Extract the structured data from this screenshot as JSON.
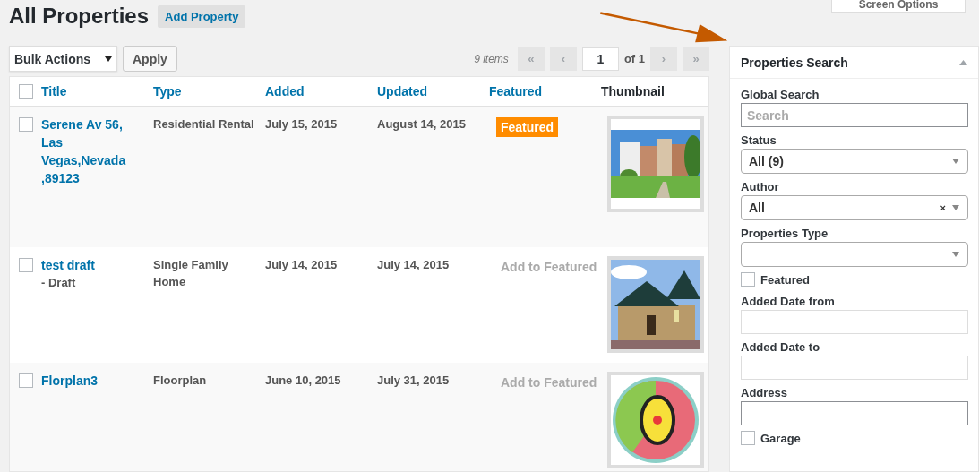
{
  "page": {
    "title": "All Properties",
    "add_button": "Add Property",
    "screen_options": "Screen Options"
  },
  "toolbar": {
    "bulk_actions": "Bulk Actions",
    "apply": "Apply",
    "items_count": "9 items",
    "pagination": {
      "first": "«",
      "prev": "‹",
      "page": "1",
      "of": "of 1",
      "next": "›",
      "last": "»"
    }
  },
  "table": {
    "select_all_checked": false,
    "columns": [
      "Title",
      "Type",
      "Added",
      "Updated",
      "Featured",
      "Thumbnail"
    ],
    "rows": [
      {
        "checked": false,
        "title": "Serene Av 56, Las Vegas,Nevada ,89123",
        "type": "Residential Rental",
        "added": "July 15, 2015",
        "updated": "August 14, 2015",
        "featured": true,
        "featured_label": "Featured"
      },
      {
        "checked": false,
        "title": "test draft",
        "title_suffix": "- Draft",
        "type": "Single Family Home",
        "added": "July 14, 2015",
        "updated": "July 14, 2015",
        "featured": false,
        "featured_label": "Add to Featured"
      },
      {
        "checked": false,
        "title": "Florplan3",
        "type": "Floorplan",
        "added": "June 10, 2015",
        "updated": "July 31, 2015",
        "featured": false,
        "featured_label": "Add to Featured"
      }
    ]
  },
  "sidebar": {
    "title": "Properties Search",
    "expanded": true,
    "fields": [
      {
        "kind": "text",
        "label": "Global Search",
        "placeholder": "Search"
      },
      {
        "kind": "select",
        "label": "Status",
        "value": "All (9)"
      },
      {
        "kind": "select",
        "label": "Author",
        "value": "All",
        "clear": "×"
      },
      {
        "kind": "select",
        "label": "Properties Type"
      },
      {
        "kind": "checkbox",
        "label": "Featured",
        "checked": false
      },
      {
        "kind": "date",
        "label": "Added Date from"
      },
      {
        "kind": "date",
        "label": "Added Date to"
      },
      {
        "kind": "text",
        "label": "Address"
      },
      {
        "kind": "checkbox",
        "label": "Garage",
        "checked": false
      }
    ]
  }
}
